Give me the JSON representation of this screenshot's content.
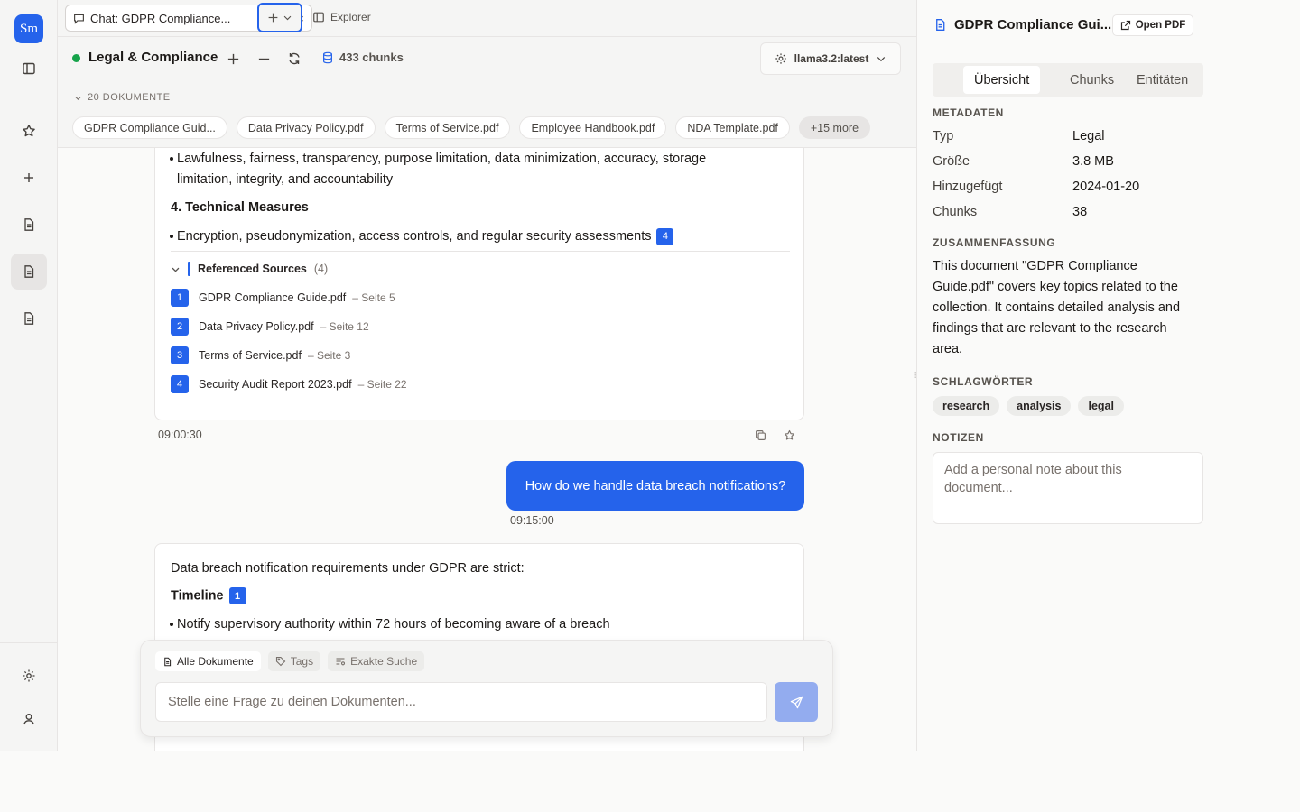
{
  "rail": {
    "logo": "Sm",
    "icons": [
      "sidebar-toggle-icon",
      "star-icon",
      "plus-icon",
      "document-icon",
      "document-icon",
      "document-icon",
      "gear-icon",
      "user-icon"
    ]
  },
  "tabbar": {
    "tab_title": "Chat: GDPR Compliance...",
    "tab_close": "×",
    "explorer_label": "Explorer"
  },
  "toolbar": {
    "collection_name": "Legal & Compliance",
    "chunk_count": "433 chunks",
    "model": "llama3.2:latest",
    "status_color": "#16a34a"
  },
  "docs": {
    "header": "20 DOKUMENTE",
    "chips": [
      "GDPR Compliance Guid...",
      "Data Privacy Policy.pdf",
      "Terms of Service.pdf",
      "Employee Handbook.pdf",
      "NDA Template.pdf"
    ],
    "more": "+15 more"
  },
  "chat": {
    "msg1": {
      "bullet_principles": "Lawfulness, fairness, transparency, purpose limitation, data minimization, accuracy, storage limitation, integrity, and accountability",
      "heading_tech": "4. Technical Measures",
      "bullet_tech": "Encryption, pseudonymization, access controls, and regular security assessments",
      "bullet_tech_ref": "4",
      "refs_label": "Referenced Sources",
      "refs_count": "(4)",
      "refs": [
        {
          "num": "1",
          "file": "GDPR Compliance Guide.pdf",
          "page": "– Seite 5"
        },
        {
          "num": "2",
          "file": "Data Privacy Policy.pdf",
          "page": "– Seite 12"
        },
        {
          "num": "3",
          "file": "Terms of Service.pdf",
          "page": "– Seite 3"
        },
        {
          "num": "4",
          "file": "Security Audit Report 2023.pdf",
          "page": "– Seite 22"
        }
      ],
      "timestamp": "09:00:30"
    },
    "user_msg": {
      "text": "How do we handle data breach notifications?",
      "timestamp": "09:15:00"
    },
    "msg2": {
      "intro": "Data breach notification requirements under GDPR are strict:",
      "heading": "Timeline",
      "heading_ref": "1",
      "bullet": "Notify supervisory authority within 72 hours of becoming aware of a breach"
    }
  },
  "input": {
    "filters": [
      "Alle Dokumente",
      "Tags",
      "Exakte Suche"
    ],
    "placeholder": "Stelle eine Frage zu deinen Dokumenten..."
  },
  "panel": {
    "title": "GDPR Compliance Gui...",
    "open_pdf": "Open PDF",
    "tabs": [
      "Übersicht",
      "Chunks",
      "Entitäten"
    ],
    "active_tab": "Übersicht",
    "metadata_header": "METADATEN",
    "metadata": [
      {
        "label": "Typ",
        "value": "Legal"
      },
      {
        "label": "Größe",
        "value": "3.8 MB"
      },
      {
        "label": "Hinzugefügt",
        "value": "2024-01-20"
      },
      {
        "label": "Chunks",
        "value": "38"
      }
    ],
    "summary_header": "ZUSAMMENFASSUNG",
    "summary": "This document \"GDPR Compliance Guide.pdf\" covers key topics related to the collection. It contains detailed analysis and findings that are relevant to the research area.",
    "keywords_header": "SCHLAGWÖRTER",
    "keywords": [
      "research",
      "analysis",
      "legal"
    ],
    "notes_header": "NOTIZEN",
    "notes_placeholder": "Add a personal note about this document..."
  }
}
